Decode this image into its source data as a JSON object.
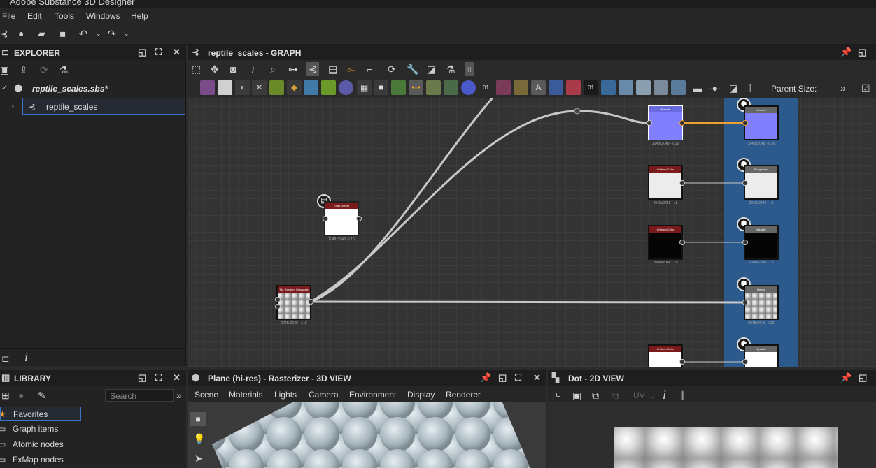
{
  "app_title": "Adobe Substance 3D Designer",
  "menu": [
    "File",
    "Edit",
    "Tools",
    "Windows",
    "Help"
  ],
  "explorer": {
    "title": "EXPLORER",
    "package": "reptile_scales.sbs*",
    "graph_item": "reptile_scales"
  },
  "graph": {
    "title": "reptile_scales - GRAPH",
    "parent_size_label": "Parent Size:",
    "nodes": {
      "edge_detect": {
        "title": "Edge Detect",
        "label": "2048x2048 - L16"
      },
      "tile_random": {
        "title": "Tile Random Grayscale",
        "label": "2048x2048 - L16"
      },
      "normal_src": {
        "title": "Normal",
        "label": "2048x2048 - C16"
      },
      "uniform1": {
        "title": "Uniform Color",
        "label": "2048x2048 - L8"
      },
      "uniform2": {
        "title": "Uniform Color",
        "label": "2048x2048 - L8"
      },
      "uniform3": {
        "title": "Uniform Color",
        "label": ""
      },
      "out_normal": {
        "title": "Normal",
        "label": "2048x2048 - C16"
      },
      "out_roughness": {
        "title": "Roughness",
        "label": "2048x2048 - L8"
      },
      "out_metallic": {
        "title": "Metallic",
        "label": "2048x2048 - L8"
      },
      "out_height": {
        "title": "Height",
        "label": "2048x2048 - L16"
      },
      "out_opacity": {
        "title": "Opacity",
        "label": ""
      }
    }
  },
  "library": {
    "title": "LIBRARY",
    "search_placeholder": "Search",
    "items": [
      "Favorites",
      "Graph items",
      "Atomic nodes",
      "FxMap nodes"
    ]
  },
  "view3d": {
    "title": "Plane (hi-res) - Rasterizer - 3D VIEW",
    "menu": [
      "Scene",
      "Materials",
      "Lights",
      "Camera",
      "Environment",
      "Display",
      "Renderer"
    ]
  },
  "view2d": {
    "title": "Dot - 2D VIEW",
    "uv_label": "UV"
  },
  "colors": {
    "accent": "#f0a030",
    "selection": "#3a74c4",
    "output_frame": "#2d5a8c"
  }
}
